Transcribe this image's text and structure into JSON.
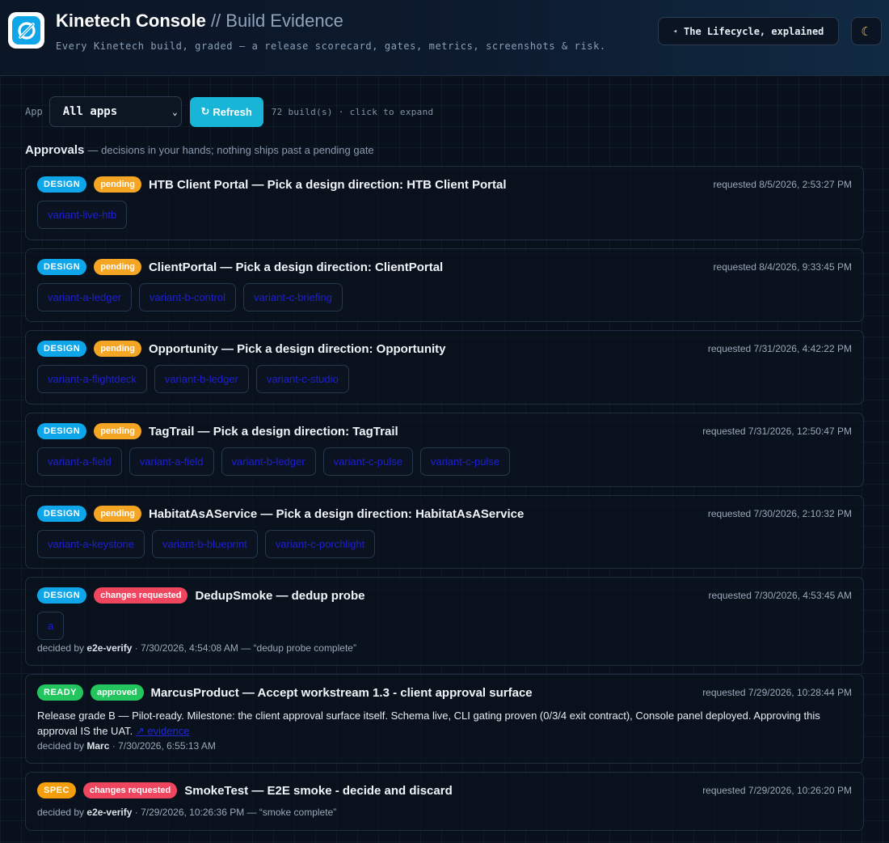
{
  "header": {
    "title": "Kinetech Console",
    "subtitle": "// Build Evidence",
    "tagline": "Every Kinetech build, graded — a release scorecard, gates, metrics, screenshots & risk.",
    "lifecycle_label": "The Lifecycle, explained",
    "lifecycle_icon": "◂",
    "theme_icon": "☾"
  },
  "toolbar": {
    "app_label": "App",
    "app_selected": "All apps",
    "refresh_label": "Refresh",
    "refresh_icon": "↻",
    "build_count": "72 build(s) · click to expand"
  },
  "approvals": {
    "heading": "Approvals",
    "hint": "— decisions in your hands; nothing ships past a pending gate",
    "items": [
      {
        "kind": "DESIGN",
        "status": "pending",
        "title": "HTB Client Portal — Pick a design direction: HTB Client Portal",
        "requested": "requested 8/5/2026, 2:53:27 PM",
        "variants": [
          "variant-live-htb"
        ]
      },
      {
        "kind": "DESIGN",
        "status": "pending",
        "title": "ClientPortal — Pick a design direction: ClientPortal",
        "requested": "requested 8/4/2026, 9:33:45 PM",
        "variants": [
          "variant-a-ledger",
          "variant-b-control",
          "variant-c-briefing"
        ]
      },
      {
        "kind": "DESIGN",
        "status": "pending",
        "title": "Opportunity — Pick a design direction: Opportunity",
        "requested": "requested 7/31/2026, 4:42:22 PM",
        "variants": [
          "variant-a-flightdeck",
          "variant-b-ledger",
          "variant-c-studio"
        ]
      },
      {
        "kind": "DESIGN",
        "status": "pending",
        "title": "TagTrail — Pick a design direction: TagTrail",
        "requested": "requested 7/31/2026, 12:50:47 PM",
        "variants": [
          "variant-a-field",
          "variant-a-field",
          "variant-b-ledger",
          "variant-c-pulse",
          "variant-c-pulse"
        ]
      },
      {
        "kind": "DESIGN",
        "status": "pending",
        "title": "HabitatAsAService — Pick a design direction: HabitatAsAService",
        "requested": "requested 7/30/2026, 2:10:32 PM",
        "variants": [
          "variant-a-keystone",
          "variant-b-blueprint",
          "variant-c-porchlight"
        ]
      },
      {
        "kind": "DESIGN",
        "status": "changes requested",
        "title": "DedupSmoke — dedup probe",
        "requested": "requested 7/30/2026, 4:53:45 AM",
        "variants": [
          "a"
        ],
        "decided_prefix": "decided by",
        "decided_by": "e2e-verify",
        "decided_rest": "· 7/30/2026, 4:54:08 AM — “dedup probe complete”"
      },
      {
        "kind": "READY",
        "status": "approved",
        "title": "MarcusProduct — Accept workstream 1.3 - client approval surface",
        "requested": "requested 7/29/2026, 10:28:44 PM",
        "description": "Release grade B — Pilot-ready. Milestone: the client approval surface itself. Schema live, CLI gating proven (0/3/4 exit contract), Console panel deployed. Approving this approval IS the UAT.",
        "evidence_link": "↗ evidence",
        "decided_prefix": "decided by",
        "decided_by": "Marc",
        "decided_rest": "· 7/30/2026, 6:55:13 AM"
      },
      {
        "kind": "SPEC",
        "status": "changes requested",
        "title": "SmokeTest — E2E smoke - decide and discard",
        "requested": "requested 7/29/2026, 10:26:20 PM",
        "decided_prefix": "decided by",
        "decided_by": "e2e-verify",
        "decided_rest": "· 7/29/2026, 10:26:36 PM — “smoke complete”"
      }
    ]
  },
  "colors": {
    "design_badge": "#0ea5e9",
    "ready_badge": "#22c55e",
    "spec_badge": "#f59e0b",
    "pending_badge": "#f4a524",
    "changes_badge": "#f0455f",
    "approved_badge": "#22c55e",
    "accent": "#19b5d8",
    "variant_link": "#1e1fd6"
  }
}
